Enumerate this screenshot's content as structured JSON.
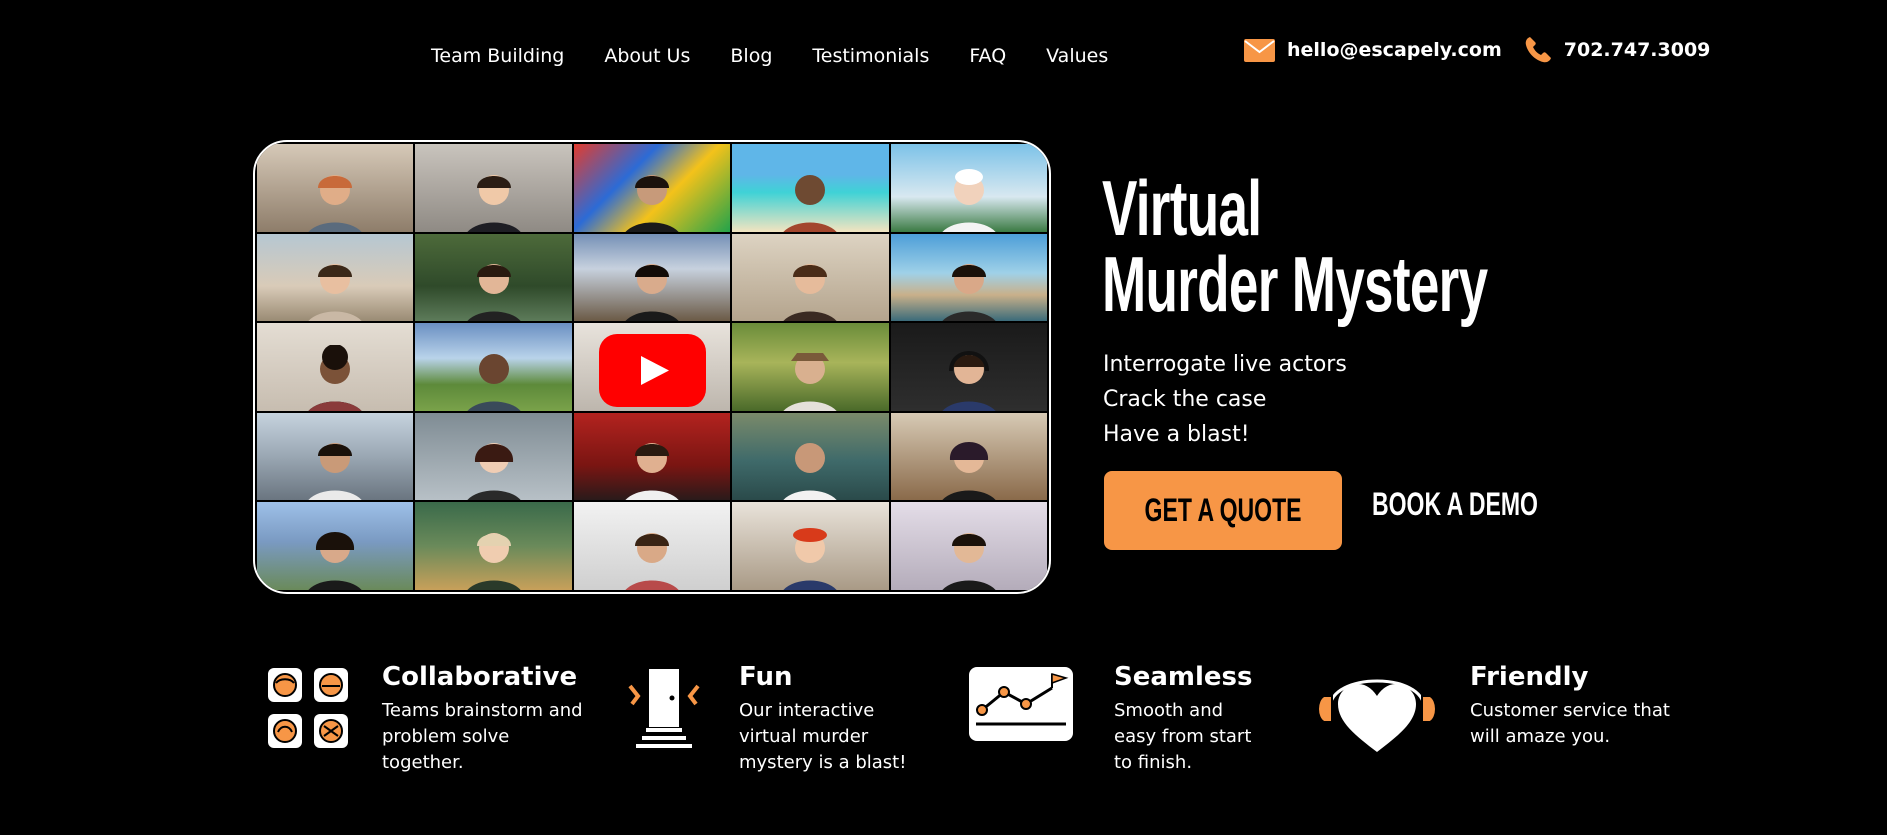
{
  "nav": {
    "items": [
      {
        "label": "Team Building"
      },
      {
        "label": "About Us"
      },
      {
        "label": "Blog"
      },
      {
        "label": "Testimonials"
      },
      {
        "label": "FAQ"
      },
      {
        "label": "Values"
      }
    ]
  },
  "contact": {
    "email": "hello@escapely.com",
    "phone": "702.747.3009",
    "icons": [
      "mail-icon",
      "phone-icon"
    ],
    "icon_color": "#f79646"
  },
  "hero": {
    "title_line1": "Virtual",
    "title_line2": "Murder Mystery",
    "taglines": [
      "Interrogate live actors",
      "Crack the case",
      "Have a blast!"
    ],
    "quote_button": "GET A QUOTE",
    "demo_button": "BOOK A DEMO",
    "video": {
      "play_icon": "youtube-play-icon",
      "play_color": "#ff0000"
    }
  },
  "features": [
    {
      "icon": "team-faces-icon",
      "title": "Collaborative",
      "lines": [
        "Teams brainstorm and",
        "problem solve",
        "together."
      ]
    },
    {
      "icon": "door-icon",
      "title": "Fun",
      "lines": [
        "Our interactive",
        "virtual murder",
        "mystery is a blast!"
      ]
    },
    {
      "icon": "progress-chart-icon",
      "title": "Seamless",
      "lines": [
        "Smooth and",
        "easy from start",
        "to finish."
      ]
    },
    {
      "icon": "heart-headset-icon",
      "title": "Friendly",
      "lines": [
        "Customer service that",
        "will amaze you."
      ]
    }
  ],
  "colors": {
    "accent": "#f79646",
    "background": "#000000",
    "text": "#ffffff"
  }
}
